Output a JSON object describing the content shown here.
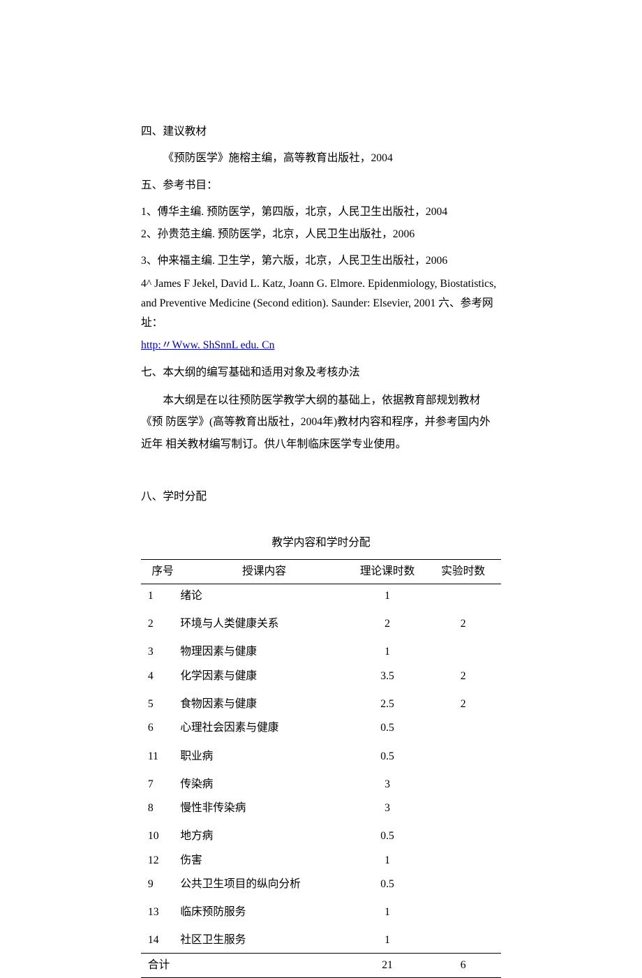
{
  "sections": {
    "four_heading": "四、建议教材",
    "four_body": "《预防医学》施榕主编，高等教育出版社，2004",
    "five_heading": "五、参考书目：",
    "five_items": [
      "1、傅华主编. 预防医学，第四版，北京，人民卫生出版社，2004",
      "2、孙贵范主编. 预防医学，北京，人民卫生出版社，2006",
      "3、仲来福主编. 卫生学，第六版，北京，人民卫生出版社，2006"
    ],
    "five_item4_prefix": "4^ James F Jekel, David L. Katz, Joann G. Elmore. Epidenmiology, Biostatistics, and Preventive Medicine (Second edition). Saunder: Elsevier, 2001 六、参考网址：",
    "six_link": "http:〃Www. ShSnnL edu. Cn",
    "seven_heading": "七、本大纲的编写基础和适用对象及考核办法",
    "seven_body": "本大纲是在以往预防医学教学大纲的基础上，依据教育部规划教材《预 防医学》(高等教育出版社，2004年)教材内容和程序，并参考国内外近年 相关教材编写制订。供八年制临床医学专业使用。",
    "eight_heading": "八、学时分配"
  },
  "table": {
    "title": "教学内容和学时分配",
    "headers": {
      "seq": "序号",
      "topic": "授课内容",
      "theory": "理论课时数",
      "lab": "实验时数"
    },
    "rows": [
      {
        "seq": "1",
        "topic": "绪论",
        "theory": "1",
        "lab": ""
      },
      {
        "seq": "2",
        "topic": "环境与人类健康关系",
        "theory": "2",
        "lab": "2"
      },
      {
        "seq": "3",
        "topic": "物理因素与健康",
        "theory": "1",
        "lab": ""
      },
      {
        "seq": "4",
        "topic": "化学因素与健康",
        "theory": "3.5",
        "lab": "2"
      },
      {
        "seq": "5",
        "topic": "食物因素与健康",
        "theory": "2.5",
        "lab": "2"
      },
      {
        "seq": "6",
        "topic": "心理社会因素与健康",
        "theory": "0.5",
        "lab": ""
      },
      {
        "seq": "11",
        "topic": "职业病",
        "theory": "0.5",
        "lab": ""
      },
      {
        "seq": "7",
        "topic": "传染病",
        "theory": "3",
        "lab": ""
      },
      {
        "seq": "8",
        "topic": "慢性非传染病",
        "theory": "3",
        "lab": ""
      },
      {
        "seq": "10",
        "topic": "地方病",
        "theory": "0.5",
        "lab": ""
      },
      {
        "seq": "12",
        "topic": "伤害",
        "theory": "1",
        "lab": ""
      },
      {
        "seq": "9",
        "topic": "公共卫生项目的纵向分析",
        "theory": "0.5",
        "lab": ""
      },
      {
        "seq": "13",
        "topic": "临床预防服务",
        "theory": "1",
        "lab": ""
      },
      {
        "seq": "14",
        "topic": "社区卫生服务",
        "theory": "1",
        "lab": ""
      }
    ],
    "total": {
      "label": "合计",
      "theory": "21",
      "lab": "6"
    }
  },
  "chart_data": {
    "type": "table",
    "title": "教学内容和学时分配",
    "columns": [
      "序号",
      "授课内容",
      "理论课时数",
      "实验时数"
    ],
    "rows": [
      [
        1,
        "绪论",
        1,
        null
      ],
      [
        2,
        "环境与人类健康关系",
        2,
        2
      ],
      [
        3,
        "物理因素与健康",
        1,
        null
      ],
      [
        4,
        "化学因素与健康",
        3.5,
        2
      ],
      [
        5,
        "食物因素与健康",
        2.5,
        2
      ],
      [
        6,
        "心理社会因素与健康",
        0.5,
        null
      ],
      [
        11,
        "职业病",
        0.5,
        null
      ],
      [
        7,
        "传染病",
        3,
        null
      ],
      [
        8,
        "慢性非传染病",
        3,
        null
      ],
      [
        10,
        "地方病",
        0.5,
        null
      ],
      [
        12,
        "伤害",
        1,
        null
      ],
      [
        9,
        "公共卫生项目的纵向分析",
        0.5,
        null
      ],
      [
        13,
        "临床预防服务",
        1,
        null
      ],
      [
        14,
        "社区卫生服务",
        1,
        null
      ]
    ],
    "totals": {
      "理论课时数": 21,
      "实验时数": 6
    }
  }
}
